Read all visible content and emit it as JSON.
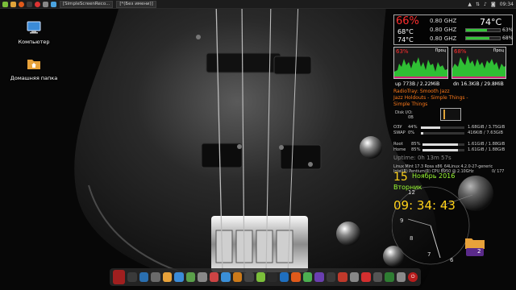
{
  "top_panel": {
    "tasks": [
      "[SimpleScreenReco...",
      "[*(Без имени)]"
    ],
    "clock": "09:34"
  },
  "desktop_icons": [
    {
      "label": "Компьютер",
      "icon": "computer-icon"
    },
    {
      "label": "Домашняя папка",
      "icon": "home-folder-icon"
    }
  ],
  "conky": {
    "cpu1": {
      "pct": "66%",
      "t1": "68°C",
      "t2": "74°C",
      "ghz": [
        "0.80 GHZ",
        "0.80 GHZ",
        "0.80 GHZ"
      ],
      "bars": [
        0.63,
        0.63,
        0.68
      ],
      "bar_labels": [
        "",
        "63%",
        "68%"
      ]
    },
    "cpu_temp_big": "74°C",
    "graph1_label": "63%",
    "graph2_label": "68%",
    "graph_small_label": "Проц",
    "net_up": "up 773B  / 2.22MiB",
    "net_dn": "dn 16.3KiB / 29.8MiB",
    "radio_tray": "RadioTray: Smooth Jazz",
    "radio_song": "Jazz Holdouts - Simple Things -",
    "radio_song2": "Simple Things",
    "disk_io_label": "Disk I/O:",
    "disk_io_value": "0B",
    "mem": [
      {
        "name": "ОЗУ",
        "pct": "44%",
        "fill": 0.44,
        "value": "1.68GiB / 3.75GiB"
      },
      {
        "name": "SWAP",
        "pct": "0%",
        "fill": 0.05,
        "value": "416KiB / 7.63GiB"
      },
      {
        "name": "Root",
        "pct": "85%",
        "fill": 0.85,
        "value": "1.61GiB / 1.88GiB"
      },
      {
        "name": "Home",
        "pct": "85%",
        "fill": 0.85,
        "value": "1.61GiB / 1.88GiB"
      }
    ],
    "uptime": "Uptime: 0h 13m 57s",
    "os_line1": "Linux Mint 17.3 Rosa x86_64Linux 4.2.0-27-generic",
    "os_line2": "Intel(R) Pentium(R) CPU B950 @ 2.10GHz",
    "os_line3": "0/ 177"
  },
  "clock_widget": {
    "day": "15",
    "month_year": "Ноябрь 2016",
    "weekday": "Вторник",
    "time": "09: 34: 43",
    "dial_numbers": [
      "12",
      "6",
      "8",
      "9",
      "7"
    ]
  },
  "workspace_badge": "2",
  "dock": {
    "icons": [
      "app-icon-1",
      "app-icon-2",
      "app-icon-3",
      "app-icon-4",
      "app-icon-5",
      "app-icon-6",
      "app-icon-7",
      "app-icon-8",
      "app-icon-9",
      "app-icon-10",
      "app-icon-11",
      "app-icon-12",
      "app-icon-13",
      "app-icon-14",
      "app-icon-15",
      "app-icon-16",
      "app-icon-17",
      "app-icon-18",
      "app-icon-19",
      "app-icon-20",
      "app-icon-21",
      "app-icon-22",
      "app-icon-23",
      "app-icon-24",
      "app-icon-25",
      "power-icon"
    ]
  }
}
